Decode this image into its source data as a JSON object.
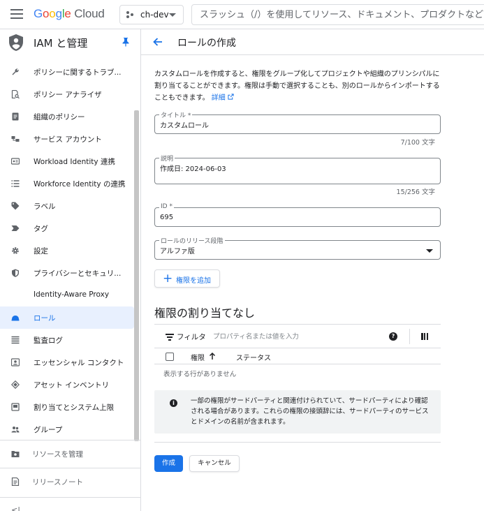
{
  "topbar": {
    "logo": {
      "g1": "G",
      "g2": "o",
      "g3": "o",
      "g4": "g",
      "g5": "l",
      "g6": "e",
      "cloud": "Cloud"
    },
    "project": "ch-dev",
    "search_placeholder": "スラッシュ（/）を使用してリソース、ドキュメント、プロダクトなどを検索"
  },
  "sidebar": {
    "title": "IAM と管理",
    "items": [
      {
        "label": "ポリシーに関するトラブ...",
        "icon": "wrench-icon"
      },
      {
        "label": "ポリシー アナライザ",
        "icon": "policy-analyzer-icon"
      },
      {
        "label": "組織のポリシー",
        "icon": "document-icon"
      },
      {
        "label": "サービス アカウント",
        "icon": "service-account-icon"
      },
      {
        "label": "Workload Identity 連携",
        "icon": "id-card-icon"
      },
      {
        "label": "Workforce Identity の連携",
        "icon": "list-icon"
      },
      {
        "label": "ラベル",
        "icon": "tag-icon"
      },
      {
        "label": "タグ",
        "icon": "tag-arrow-icon"
      },
      {
        "label": "設定",
        "icon": "gear-icon"
      },
      {
        "label": "プライバシーとセキュリ...",
        "icon": "shield-icon"
      },
      {
        "label": "Identity-Aware Proxy",
        "icon": "iap-icon"
      },
      {
        "label": "ロール",
        "icon": "role-hat-icon"
      },
      {
        "label": "監査ログ",
        "icon": "audit-log-icon"
      },
      {
        "label": "エッセンシャル コンタクト",
        "icon": "contact-icon"
      },
      {
        "label": "アセット インベントリ",
        "icon": "asset-inventory-icon"
      },
      {
        "label": "割り当てとシステム上限",
        "icon": "quota-icon"
      },
      {
        "label": "グループ",
        "icon": "group-icon"
      }
    ],
    "active_index": 11,
    "manage_resources": "リソースを管理",
    "release_notes": "リリースノート",
    "collapse": "<|"
  },
  "main": {
    "title": "ロールの作成",
    "intro_text": "カスタムロールを作成すると、権限をグループ化してプロジェクトや組織のプリンシパルに割り当てることができます。権限は手動で選択することも、別のロールからインポートすることもできます。",
    "intro_link": "詳細",
    "title_field": {
      "label": "タイトル *",
      "value": "カスタムロール",
      "counter": "7/100 文字"
    },
    "description_field": {
      "label": "説明",
      "value": "作成日: 2024-06-03",
      "counter": "15/256 文字"
    },
    "id_field": {
      "label": "ID *",
      "value": "695"
    },
    "stage_field": {
      "label": "ロールのリリース段階",
      "value": "アルファ版"
    },
    "add_permissions": "権限を追加",
    "section_title": "権限の割り当てなし",
    "filter_label": "フィルタ",
    "filter_placeholder": "プロパティ名または値を入力",
    "table": {
      "col_permission": "権限",
      "col_status": "ステータス",
      "empty": "表示する行がありません"
    },
    "info_text": "一部の権限がサードパーティと関連付けられていて、サードパーティにより確認される場合があります。これらの権限の接頭辞には、サードパーティのサービスとドメインの名前が含まれます。",
    "create_button": "作成",
    "cancel_button": "キャンセル"
  },
  "colors": {
    "accent": "#1a73e8",
    "active_bg": "#e8f0fe"
  }
}
